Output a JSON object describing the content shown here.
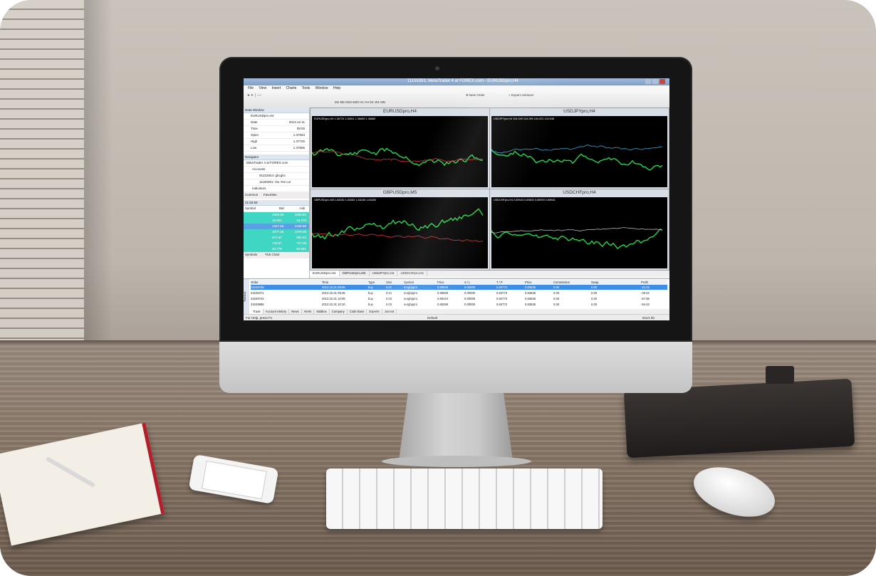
{
  "window": {
    "title": "11155391: MetaTrader 4 at FOREX.com - EURUSDpro,H4"
  },
  "menu": [
    "File",
    "View",
    "Insert",
    "Charts",
    "Tools",
    "Window",
    "Help"
  ],
  "toolbar": {
    "new_order": "New Order",
    "expert_advisors": "Expert Advisors",
    "timeframes": [
      "M1",
      "M5",
      "M15",
      "M30",
      "H1",
      "H4",
      "D1",
      "W1",
      "MN"
    ]
  },
  "data_window": {
    "title": "Data Window",
    "symbol": "EURUSDpro,H4",
    "rows": [
      {
        "k": "Date",
        "v": "2013.12.11"
      },
      {
        "k": "Time",
        "v": "08:00"
      },
      {
        "k": "Open",
        "v": "1.37663"
      },
      {
        "k": "High",
        "v": "1.37725"
      },
      {
        "k": "Low",
        "v": "1.37555"
      }
    ]
  },
  "navigator": {
    "title": "Navigator",
    "root": "MetaTrader 4 at FOREX.com",
    "accounts_label": "Accounts",
    "account1": "91222924: ghcghc",
    "account2": "11155391: Siu Yee Lui",
    "indicators_label": "Indicators",
    "tabs": [
      "Common",
      "Favorites"
    ]
  },
  "market_watch": {
    "time": "21:55:59",
    "col_symbol": "Symbol",
    "col_bid": "Bid",
    "col_ask": "Ask",
    "rows": [
      {
        "bid": "1063.66",
        "ask": "1059.84"
      },
      {
        "bid": "15.501",
        "ask": "15.470"
      },
      {
        "bid": "1347.86",
        "ask": "1348.59"
      },
      {
        "bid": "1077.46",
        "ask": "1079.06"
      },
      {
        "bid": "874.97",
        "ask": "882.63"
      },
      {
        "bid": "733.87",
        "ask": "737.08"
      },
      {
        "bid": "93.778",
        "ask": "93.691"
      }
    ],
    "tabs": [
      "Symbols",
      "Tick Chart"
    ]
  },
  "charts": [
    {
      "title": "EURUSDpro,H4",
      "info": "EURUSDpro,H4  1.36723 1.36811 1.36665 1.36680"
    },
    {
      "title": "USDJPYpro,H4",
      "info": "USDJPYpro,H4  104.049 104.095 104.021 104.046"
    },
    {
      "title": "GBPUSDpro,M5",
      "info": "GBPUSDpro,M5  1.63282 1.63282 1.63245 1.63260"
    },
    {
      "title": "USDCHFpro,H4",
      "info": "USDCHFpro,H4  0.89943 0.89600 0.89909 0.89945"
    }
  ],
  "chart_tabs": [
    "EURUSDpro,H4",
    "GBPUSDpro,M5",
    "USDJPYpro,H4",
    "USDCHFpro,H4"
  ],
  "terminal": {
    "headers": [
      "Order",
      "Time",
      "Type",
      "Size",
      "Symbol",
      "Price",
      "S / L",
      "T / P",
      "Price",
      "Commission",
      "Swap",
      "Profit"
    ],
    "rows": [
      [
        "23249709",
        "2013.10.31 09:05",
        "buy",
        "0.01",
        "eurgbppro",
        "0.85526",
        "0.00000",
        "0.84772",
        "0.83635",
        "0.00",
        "0.00",
        "-21.02"
      ],
      [
        "23249471",
        "2013.10.31 09:45",
        "buy",
        "0.01",
        "eurgbppro",
        "0.85509",
        "0.00000",
        "0.84773",
        "0.83635",
        "0.00",
        "0.00",
        "-30.52"
      ],
      [
        "23249722",
        "2013.10.31 10:09",
        "buy",
        "0.02",
        "eurgbppro",
        "0.85410",
        "0.00000",
        "0.84773",
        "0.83635",
        "0.00",
        "0.00",
        "-57.86"
      ],
      [
        "23249886",
        "2013.10.31 10:10",
        "buy",
        "0.03",
        "eurgbppro",
        "0.85359",
        "0.00000",
        "0.84772",
        "0.83635",
        "0.00",
        "0.00",
        "-84.43"
      ]
    ],
    "tabs": [
      "Trade",
      "Account History",
      "News",
      "Alerts",
      "Mailbox",
      "Company",
      "Code Base",
      "Experts",
      "Journal"
    ],
    "side_label": "Terminal"
  },
  "status": {
    "help": "For Help, press F1",
    "profile": "Default",
    "traffic": "611/1 kb"
  }
}
